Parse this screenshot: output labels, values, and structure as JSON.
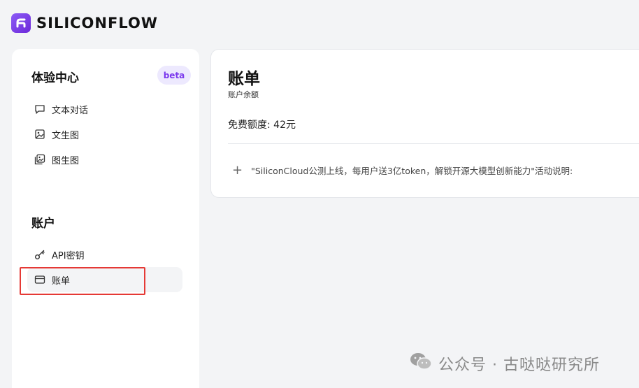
{
  "brand": {
    "name": "SILICONFLOW"
  },
  "sidebar": {
    "experience": {
      "title": "体验中心",
      "badge": "beta",
      "items": [
        {
          "label": "文本对话",
          "icon": "chat-bubble-icon"
        },
        {
          "label": "文生图",
          "icon": "image-icon"
        },
        {
          "label": "图生图",
          "icon": "images-icon"
        }
      ]
    },
    "account": {
      "title": "账户",
      "items": [
        {
          "label": "API密钥",
          "icon": "key-icon"
        },
        {
          "label": "账单",
          "icon": "card-icon",
          "active": true
        }
      ]
    }
  },
  "main": {
    "title": "账单",
    "subtitle": "账户余额",
    "quota": "免费额度: 42元",
    "expand_text": "\"SiliconCloud公测上线，每用户送3亿token，解锁开源大模型创新能力\"活动说明:"
  },
  "watermark": {
    "text": "公众号 · 古哒哒研究所"
  },
  "colors": {
    "accent": "#7c3aed",
    "highlight": "#e53935"
  }
}
